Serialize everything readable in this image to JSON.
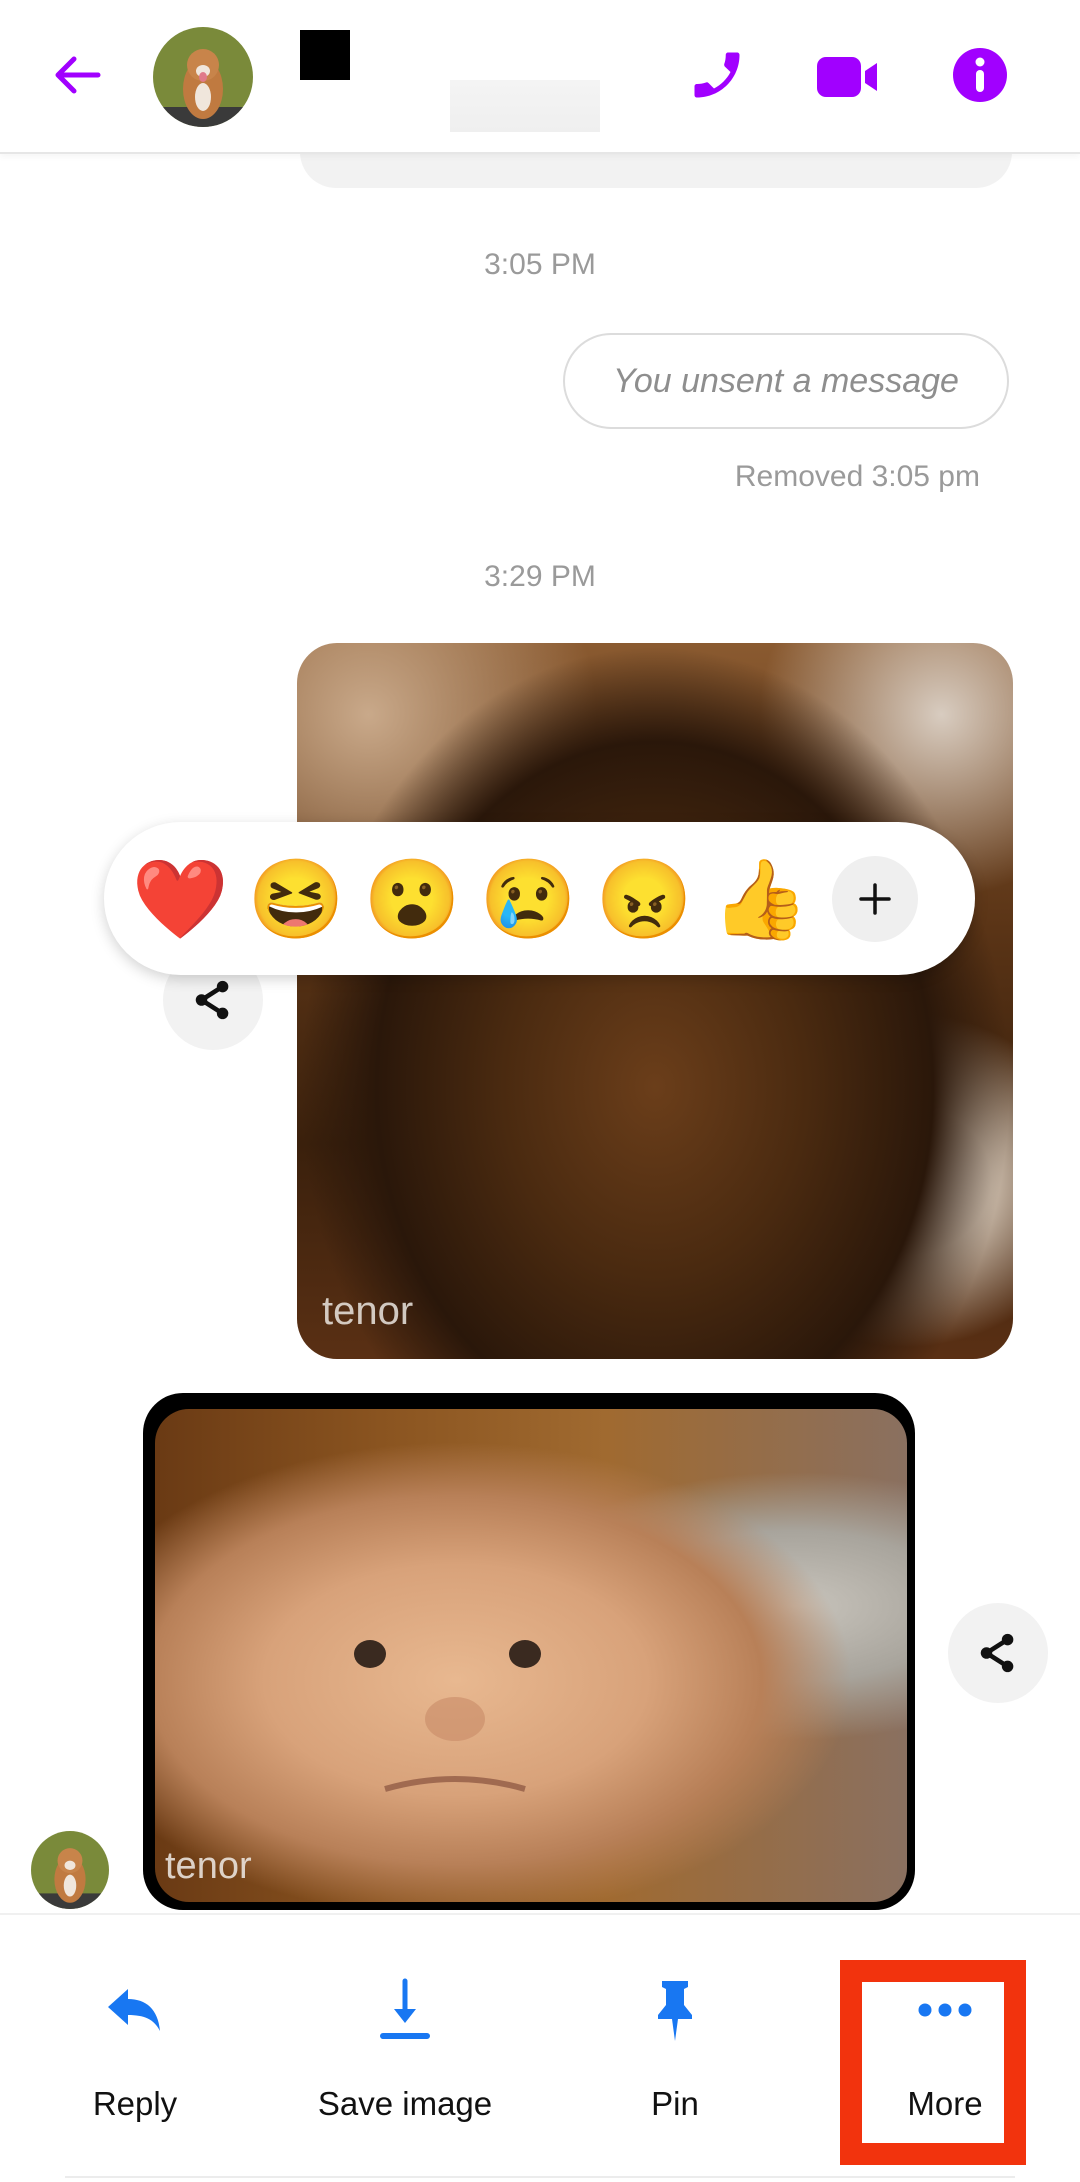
{
  "header": {
    "contact_name_redacted": true,
    "icons": [
      "back-arrow-icon",
      "phone-icon",
      "video-camera-icon",
      "info-icon"
    ],
    "accent_color": "#a100ff"
  },
  "conversation": {
    "timestamps": [
      "3:05 PM",
      "3:29 PM"
    ],
    "unsent_message": "You unsent a message",
    "removed_label": "Removed 3:05 pm",
    "gifs": [
      {
        "watermark": "tenor",
        "sender": "me"
      },
      {
        "watermark": "tenor",
        "sender": "contact"
      }
    ]
  },
  "reaction_bar": {
    "reactions": [
      "❤️",
      "😆",
      "😮",
      "😢",
      "😠",
      "👍"
    ],
    "more_label": "+"
  },
  "action_sheet": {
    "accent_color": "#1877f2",
    "highlight_color": "#f2330d",
    "actions": [
      {
        "label": "Reply",
        "icon": "reply-icon"
      },
      {
        "label": "Save image",
        "icon": "download-icon"
      },
      {
        "label": "Pin",
        "icon": "pin-icon"
      },
      {
        "label": "More",
        "icon": "more-dots-icon"
      }
    ]
  }
}
